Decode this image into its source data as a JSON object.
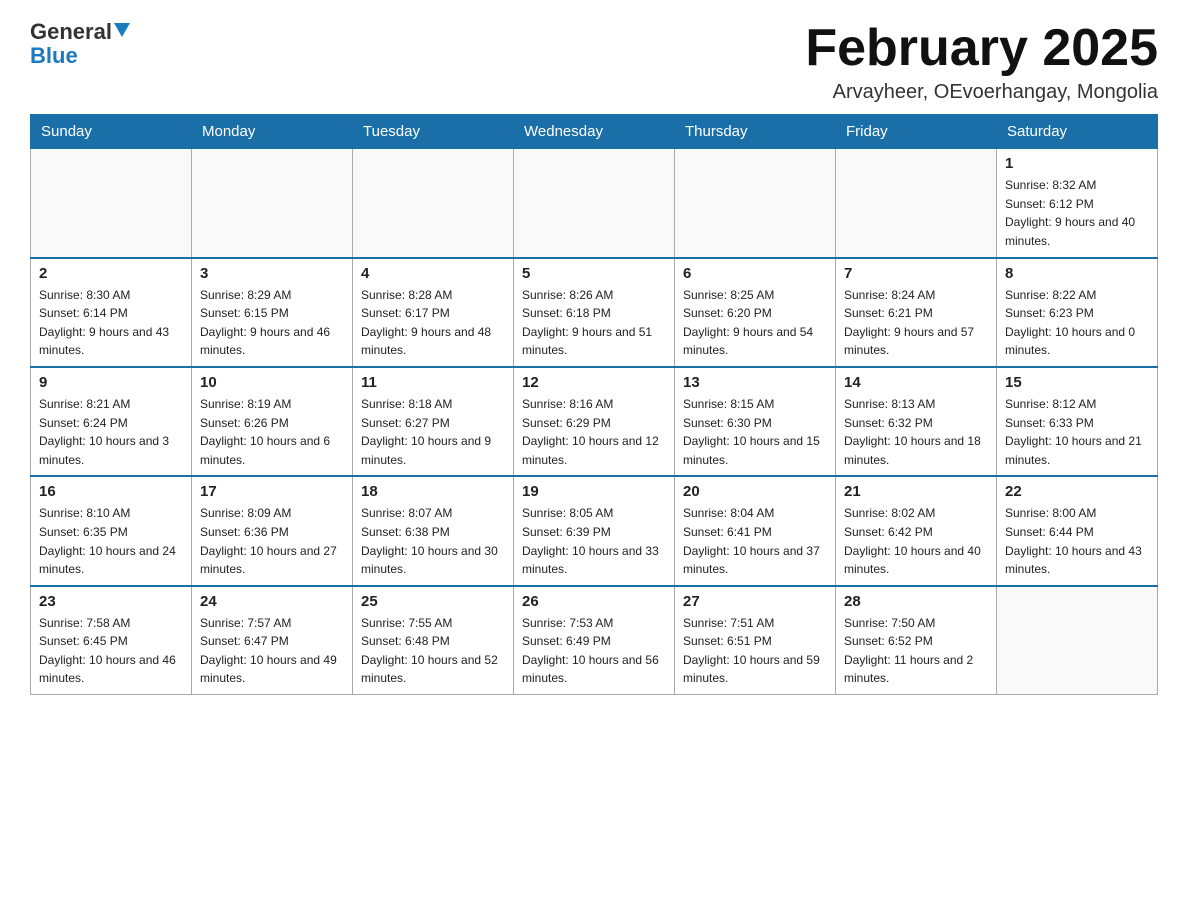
{
  "header": {
    "logo_line1": "General",
    "logo_line2": "Blue",
    "title": "February 2025",
    "subtitle": "Arvayheer, OEvoerhangay, Mongolia"
  },
  "days_of_week": [
    "Sunday",
    "Monday",
    "Tuesday",
    "Wednesday",
    "Thursday",
    "Friday",
    "Saturday"
  ],
  "weeks": [
    {
      "days": [
        {
          "num": "",
          "info": ""
        },
        {
          "num": "",
          "info": ""
        },
        {
          "num": "",
          "info": ""
        },
        {
          "num": "",
          "info": ""
        },
        {
          "num": "",
          "info": ""
        },
        {
          "num": "",
          "info": ""
        },
        {
          "num": "1",
          "info": "Sunrise: 8:32 AM\nSunset: 6:12 PM\nDaylight: 9 hours and 40 minutes."
        }
      ]
    },
    {
      "days": [
        {
          "num": "2",
          "info": "Sunrise: 8:30 AM\nSunset: 6:14 PM\nDaylight: 9 hours and 43 minutes."
        },
        {
          "num": "3",
          "info": "Sunrise: 8:29 AM\nSunset: 6:15 PM\nDaylight: 9 hours and 46 minutes."
        },
        {
          "num": "4",
          "info": "Sunrise: 8:28 AM\nSunset: 6:17 PM\nDaylight: 9 hours and 48 minutes."
        },
        {
          "num": "5",
          "info": "Sunrise: 8:26 AM\nSunset: 6:18 PM\nDaylight: 9 hours and 51 minutes."
        },
        {
          "num": "6",
          "info": "Sunrise: 8:25 AM\nSunset: 6:20 PM\nDaylight: 9 hours and 54 minutes."
        },
        {
          "num": "7",
          "info": "Sunrise: 8:24 AM\nSunset: 6:21 PM\nDaylight: 9 hours and 57 minutes."
        },
        {
          "num": "8",
          "info": "Sunrise: 8:22 AM\nSunset: 6:23 PM\nDaylight: 10 hours and 0 minutes."
        }
      ]
    },
    {
      "days": [
        {
          "num": "9",
          "info": "Sunrise: 8:21 AM\nSunset: 6:24 PM\nDaylight: 10 hours and 3 minutes."
        },
        {
          "num": "10",
          "info": "Sunrise: 8:19 AM\nSunset: 6:26 PM\nDaylight: 10 hours and 6 minutes."
        },
        {
          "num": "11",
          "info": "Sunrise: 8:18 AM\nSunset: 6:27 PM\nDaylight: 10 hours and 9 minutes."
        },
        {
          "num": "12",
          "info": "Sunrise: 8:16 AM\nSunset: 6:29 PM\nDaylight: 10 hours and 12 minutes."
        },
        {
          "num": "13",
          "info": "Sunrise: 8:15 AM\nSunset: 6:30 PM\nDaylight: 10 hours and 15 minutes."
        },
        {
          "num": "14",
          "info": "Sunrise: 8:13 AM\nSunset: 6:32 PM\nDaylight: 10 hours and 18 minutes."
        },
        {
          "num": "15",
          "info": "Sunrise: 8:12 AM\nSunset: 6:33 PM\nDaylight: 10 hours and 21 minutes."
        }
      ]
    },
    {
      "days": [
        {
          "num": "16",
          "info": "Sunrise: 8:10 AM\nSunset: 6:35 PM\nDaylight: 10 hours and 24 minutes."
        },
        {
          "num": "17",
          "info": "Sunrise: 8:09 AM\nSunset: 6:36 PM\nDaylight: 10 hours and 27 minutes."
        },
        {
          "num": "18",
          "info": "Sunrise: 8:07 AM\nSunset: 6:38 PM\nDaylight: 10 hours and 30 minutes."
        },
        {
          "num": "19",
          "info": "Sunrise: 8:05 AM\nSunset: 6:39 PM\nDaylight: 10 hours and 33 minutes."
        },
        {
          "num": "20",
          "info": "Sunrise: 8:04 AM\nSunset: 6:41 PM\nDaylight: 10 hours and 37 minutes."
        },
        {
          "num": "21",
          "info": "Sunrise: 8:02 AM\nSunset: 6:42 PM\nDaylight: 10 hours and 40 minutes."
        },
        {
          "num": "22",
          "info": "Sunrise: 8:00 AM\nSunset: 6:44 PM\nDaylight: 10 hours and 43 minutes."
        }
      ]
    },
    {
      "days": [
        {
          "num": "23",
          "info": "Sunrise: 7:58 AM\nSunset: 6:45 PM\nDaylight: 10 hours and 46 minutes."
        },
        {
          "num": "24",
          "info": "Sunrise: 7:57 AM\nSunset: 6:47 PM\nDaylight: 10 hours and 49 minutes."
        },
        {
          "num": "25",
          "info": "Sunrise: 7:55 AM\nSunset: 6:48 PM\nDaylight: 10 hours and 52 minutes."
        },
        {
          "num": "26",
          "info": "Sunrise: 7:53 AM\nSunset: 6:49 PM\nDaylight: 10 hours and 56 minutes."
        },
        {
          "num": "27",
          "info": "Sunrise: 7:51 AM\nSunset: 6:51 PM\nDaylight: 10 hours and 59 minutes."
        },
        {
          "num": "28",
          "info": "Sunrise: 7:50 AM\nSunset: 6:52 PM\nDaylight: 11 hours and 2 minutes."
        },
        {
          "num": "",
          "info": ""
        }
      ]
    }
  ]
}
